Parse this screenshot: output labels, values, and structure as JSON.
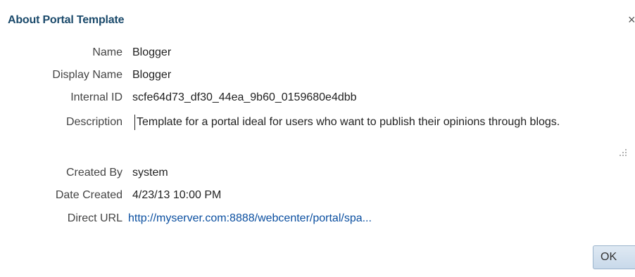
{
  "dialog": {
    "title": "About Portal Template",
    "close_glyph": "×"
  },
  "fields": {
    "name_label": "Name",
    "name_value": "Blogger",
    "display_name_label": "Display Name",
    "display_name_value": "Blogger",
    "internal_id_label": "Internal ID",
    "internal_id_value": "scfe64d73_df30_44ea_9b60_0159680e4dbb",
    "description_label": "Description",
    "description_value": "Template for a portal ideal for users who want to publish their opinions through blogs.",
    "created_by_label": "Created By",
    "created_by_value": "system",
    "date_created_label": "Date Created",
    "date_created_value": "4/23/13 10:00 PM",
    "direct_url_label": "Direct URL",
    "direct_url_value": "http://myserver.com:8888/webcenter/portal/spa..."
  },
  "buttons": {
    "ok_label": "OK"
  }
}
